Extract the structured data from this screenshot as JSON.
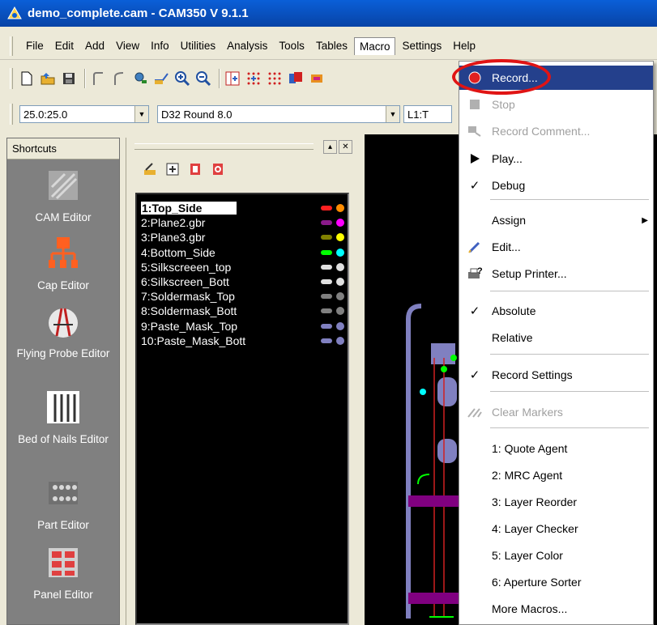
{
  "window": {
    "title": "demo_complete.cam - CAM350 V 9.1.1"
  },
  "menubar": {
    "items": [
      "File",
      "Edit",
      "Add",
      "View",
      "Info",
      "Utilities",
      "Analysis",
      "Tools",
      "Tables",
      "Macro",
      "Settings",
      "Help"
    ],
    "active": "Macro"
  },
  "toolbar": {
    "icons": [
      "new-file-icon",
      "open-file-icon",
      "save-icon",
      "select-arc-icon",
      "select-line-icon",
      "zoom-window-icon",
      "pan-icon",
      "zoom-in-icon",
      "zoom-out-icon",
      "grid-icon",
      "snap-grid-icon",
      "dots-icon",
      "layers-color-icon",
      "redraw-icon"
    ]
  },
  "combos": {
    "grid": "25.0:25.0",
    "aperture": "D32  Round 8.0",
    "layer": "L1:T"
  },
  "shortcuts": {
    "title": "Shortcuts",
    "items": [
      {
        "label": "CAM Editor",
        "icon": "cam-editor-icon"
      },
      {
        "label": "Cap Editor",
        "icon": "cap-editor-icon"
      },
      {
        "label": "Flying Probe Editor",
        "icon": "flying-probe-icon"
      },
      {
        "label": "Bed of Nails Editor",
        "icon": "bed-of-nails-icon"
      },
      {
        "label": "Part Editor",
        "icon": "part-editor-icon"
      },
      {
        "label": "Panel Editor",
        "icon": "panel-editor-icon"
      }
    ]
  },
  "layers": [
    {
      "name": "1:Top_Side",
      "color": "#ff2020",
      "dot": "#ff8c00",
      "selected": true
    },
    {
      "name": "2:Plane2.gbr",
      "color": "#8a1a8a",
      "dot": "#ff00ff"
    },
    {
      "name": "3:Plane3.gbr",
      "color": "#808000",
      "dot": "#ffff00"
    },
    {
      "name": "4:Bottom_Side",
      "color": "#00ff00",
      "dot": "#00ffff"
    },
    {
      "name": "5:Silkscreeen_top",
      "color": "#e0e0e0",
      "dot": "#e0e0e0"
    },
    {
      "name": "6:Silkscreen_Bott",
      "color": "#e0e0e0",
      "dot": "#e0e0e0"
    },
    {
      "name": "7:Soldermask_Top",
      "color": "#808080",
      "dot": "#808080"
    },
    {
      "name": "8:Soldermask_Bott",
      "color": "#808080",
      "dot": "#808080"
    },
    {
      "name": "9:Paste_Mask_Top",
      "color": "#8080c0",
      "dot": "#8080c0"
    },
    {
      "name": "10:Paste_Mask_Bott",
      "color": "#8080c0",
      "dot": "#8080c0"
    }
  ],
  "macro_menu": {
    "items": [
      {
        "label": "Record...",
        "icon": "record-icon",
        "highlight": true
      },
      {
        "label": "Stop",
        "icon": "stop-icon",
        "disabled": true
      },
      {
        "label": "Record Comment...",
        "icon": "record-comment-icon",
        "disabled": true
      },
      {
        "label": "Play...",
        "icon": "play-icon"
      },
      {
        "label": "Debug",
        "icon": "checkmark-icon"
      },
      {
        "label": "Assign",
        "icon": "",
        "submenu": true
      },
      {
        "label": "Edit...",
        "icon": "edit-icon"
      },
      {
        "label": "Setup Printer...",
        "icon": "printer-icon"
      },
      {
        "label": "Absolute",
        "icon": "checkmark-icon"
      },
      {
        "label": "Relative",
        "icon": ""
      },
      {
        "label": "Record Settings",
        "icon": "checkmark-icon"
      },
      {
        "label": "Clear Markers",
        "icon": "clear-markers-icon",
        "disabled": true
      },
      {
        "label": "1: Quote Agent",
        "icon": ""
      },
      {
        "label": "2: MRC Agent",
        "icon": ""
      },
      {
        "label": "3: Layer Reorder",
        "icon": ""
      },
      {
        "label": "4: Layer Checker",
        "icon": ""
      },
      {
        "label": "5: Layer Color",
        "icon": ""
      },
      {
        "label": "6: Aperture Sorter",
        "icon": ""
      },
      {
        "label": "More Macros...",
        "icon": ""
      }
    ]
  },
  "colors": {
    "highlight": "#24408c",
    "annotation": "#e01414",
    "titlebar": "#0a5fd8"
  }
}
